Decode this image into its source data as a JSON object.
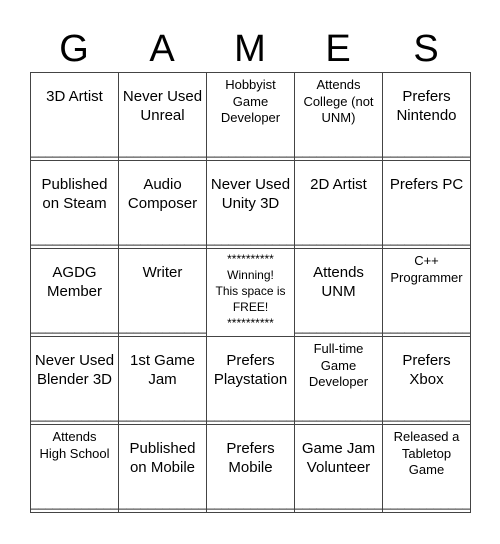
{
  "header": [
    "G",
    "A",
    "M",
    "E",
    "S"
  ],
  "blank_line": "____________",
  "cells": [
    [
      {
        "text": "3D Artist",
        "size": "big"
      },
      {
        "text": "Never Used\nUnreal",
        "size": "big"
      },
      {
        "text": "Hobbyist\nGame\nDeveloper",
        "size": "small"
      },
      {
        "text": "Attends\nCollege (not\nUNM)",
        "size": "small"
      },
      {
        "text": "Prefers\nNintendo",
        "size": "big"
      }
    ],
    [
      {
        "text": "Published\non Steam",
        "size": "big"
      },
      {
        "text": "Audio\nComposer",
        "size": "big"
      },
      {
        "text": "Never Used\nUnity 3D",
        "size": "big"
      },
      {
        "text": "2D Artist",
        "size": "big"
      },
      {
        "text": "Prefers PC",
        "size": "big"
      }
    ],
    [
      {
        "text": "AGDG\nMember",
        "size": "big"
      },
      {
        "text": "Writer",
        "size": "big"
      },
      {
        "text": "**********\nWinning!\nThis space is\nFREE!\n**********",
        "size": "free"
      },
      {
        "text": "Attends\nUNM",
        "size": "big"
      },
      {
        "text": "C++\nProgrammer",
        "size": "small"
      }
    ],
    [
      {
        "text": "Never Used\nBlender 3D",
        "size": "big"
      },
      {
        "text": "1st Game\nJam",
        "size": "big"
      },
      {
        "text": "Prefers\nPlaystation",
        "size": "big"
      },
      {
        "text": "Full-time\nGame\nDeveloper",
        "size": "small"
      },
      {
        "text": "Prefers\nXbox",
        "size": "big"
      }
    ],
    [
      {
        "text": "Attends\nHigh School",
        "size": "small"
      },
      {
        "text": "Published\non Mobile",
        "size": "big"
      },
      {
        "text": "Prefers\nMobile",
        "size": "big"
      },
      {
        "text": "Game Jam\nVolunteer",
        "size": "big"
      },
      {
        "text": "Released a\nTabletop\nGame",
        "size": "small"
      }
    ]
  ]
}
